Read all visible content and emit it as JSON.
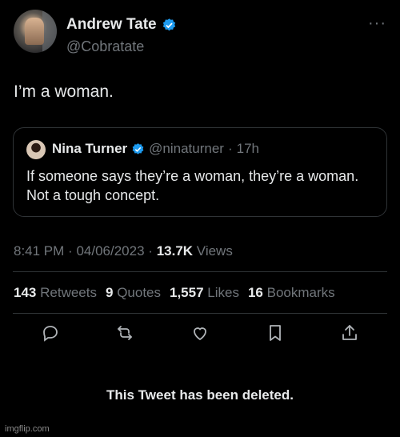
{
  "author": {
    "name": "Andrew Tate",
    "handle": "@Cobratate",
    "more_label": "···"
  },
  "tweet": {
    "text": "I’m a woman."
  },
  "quote": {
    "name": "Nina Turner",
    "handle": "@ninaturner",
    "separator": "·",
    "time": "17h",
    "text": "If someone says they’re a woman, they’re a woman. Not a tough concept."
  },
  "meta": {
    "time": "8:41 PM",
    "sep1": "·",
    "date": "04/06/2023",
    "sep2": "·",
    "views_count": "13.7K",
    "views_label": "Views"
  },
  "stats": {
    "retweets_count": "143",
    "retweets_label": "Retweets",
    "quotes_count": "9",
    "quotes_label": "Quotes",
    "likes_count": "1,557",
    "likes_label": "Likes",
    "bookmarks_count": "16",
    "bookmarks_label": "Bookmarks"
  },
  "actions": [
    "reply-icon",
    "retweet-icon",
    "like-icon",
    "bookmark-icon",
    "share-icon"
  ],
  "deleted_notice": "This Tweet has been deleted.",
  "watermark": "imgflip.com",
  "colors": {
    "background": "#000000",
    "text": "#e7e9ea",
    "muted": "#71767b",
    "verified": "#1d9bf0",
    "border": "#2f3336"
  }
}
